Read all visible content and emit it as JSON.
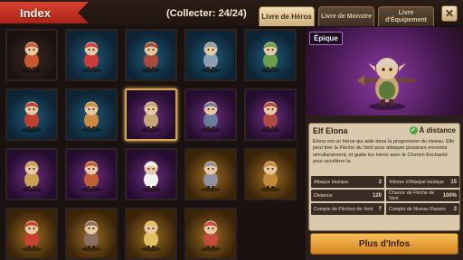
{
  "header": {
    "title": "Index",
    "counter": "(Collecter: 24/24)",
    "tabs": [
      {
        "label": "Livre de Héros",
        "active": true
      },
      {
        "label": "Livre de Monstre",
        "active": false
      },
      {
        "label": "Livre d'Équipement",
        "active": false
      }
    ],
    "close_icon": "close-icon"
  },
  "colors": {
    "rare": "#1f5a7a",
    "epic": "#6b2d80",
    "legend": "#9a6a22",
    "common": "#3a2a24",
    "selected_border": "#d9a64a",
    "button": "#f6c05a"
  },
  "heroes": [
    {
      "rarity": "common",
      "tone": "#c9582c"
    },
    {
      "rarity": "rare",
      "tone": "#d03a3a"
    },
    {
      "rarity": "rare",
      "tone": "#a84a3a"
    },
    {
      "rarity": "rare",
      "tone": "#8aa0b0"
    },
    {
      "rarity": "rare",
      "tone": "#6aa04a"
    },
    {
      "rarity": "rare",
      "tone": "#c04030"
    },
    {
      "rarity": "rare",
      "tone": "#d08a40"
    },
    {
      "rarity": "epic",
      "tone": "#c6a676",
      "selected": true
    },
    {
      "rarity": "epic",
      "tone": "#6a7a9a"
    },
    {
      "rarity": "epic",
      "tone": "#b04a40"
    },
    {
      "rarity": "epic",
      "tone": "#c8a050"
    },
    {
      "rarity": "epic",
      "tone": "#c06030"
    },
    {
      "rarity": "epic",
      "tone": "#f0f0f0"
    },
    {
      "rarity": "legend",
      "tone": "#9090a0"
    },
    {
      "rarity": "legend",
      "tone": "#c08a3a"
    },
    {
      "rarity": "legend",
      "tone": "#c84030"
    },
    {
      "rarity": "legend",
      "tone": "#8a7060"
    },
    {
      "rarity": "legend",
      "tone": "#e0c060"
    },
    {
      "rarity": "legend",
      "tone": "#c84a3a"
    }
  ],
  "detail": {
    "rarity_label": "Épique",
    "name": "Elf Elona",
    "range": "À distance",
    "range_icon": "check-icon",
    "description": "Elona est un héros qui aide dans la progression du niveau. Elle peut tirer la Flèche du Vent pour attaquer plusieurs ennemis simultanément, et guide les héros avec le Chemin Enchanté pour accélérer la",
    "stats": [
      [
        {
          "label": "Attaque basique",
          "value": "2"
        },
        {
          "label": "Vitesse d'Attaque basique",
          "value": "15"
        }
      ],
      [
        {
          "label": "Distance",
          "value": "120"
        },
        {
          "label": "Chance de Flèche de Vent",
          "value": "100%"
        }
      ],
      [
        {
          "label": "Compte de Flèches de Vent",
          "value": "7"
        },
        {
          "label": "Compte de Niveau Passés",
          "value": "3"
        }
      ]
    ],
    "more_info_label": "Plus d'Infos"
  }
}
